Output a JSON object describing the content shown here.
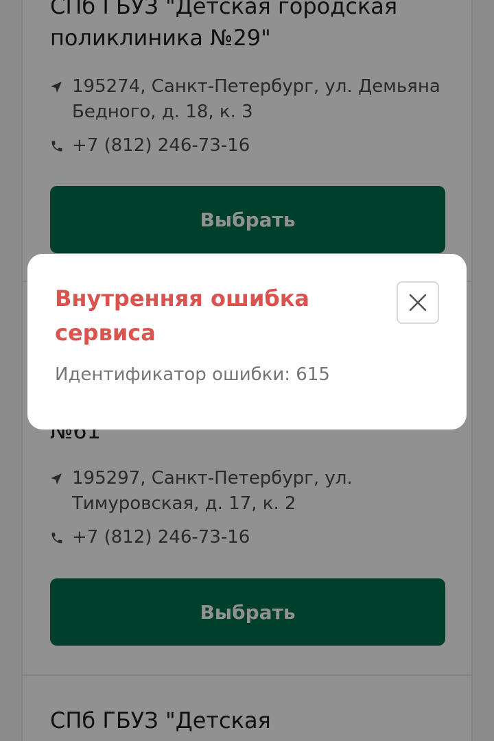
{
  "cards": [
    {
      "title_line1": "СПб ГБУЗ \"Детская городская",
      "title_line2": "поликлиника №29\"",
      "address": "195274, Санкт-Петербург, ул. Демьяна Бедного, д. 18, к. 3",
      "phone": "+7 (812) 246-73-16",
      "button_label": "Выбрать"
    },
    {
      "title_tail": "№61\"",
      "address": "195297, Санкт-Петербург, ул. Тимуровская, д. 17, к. 2",
      "phone": "+7 (812) 246-73-16",
      "button_label": "Выбрать"
    },
    {
      "title_line1": "СПб ГБУЗ \"Детская"
    }
  ],
  "modal": {
    "title": "Внутренняя ошибка сервиса",
    "message": "Идентификатор ошибки: 615"
  },
  "icons": {
    "location": "location-arrow-icon",
    "phone": "phone-icon",
    "close": "close-icon"
  },
  "colors": {
    "button": "#00704e",
    "error_title": "#d9534f",
    "overlay": "rgba(0,0,0,0.43)"
  }
}
